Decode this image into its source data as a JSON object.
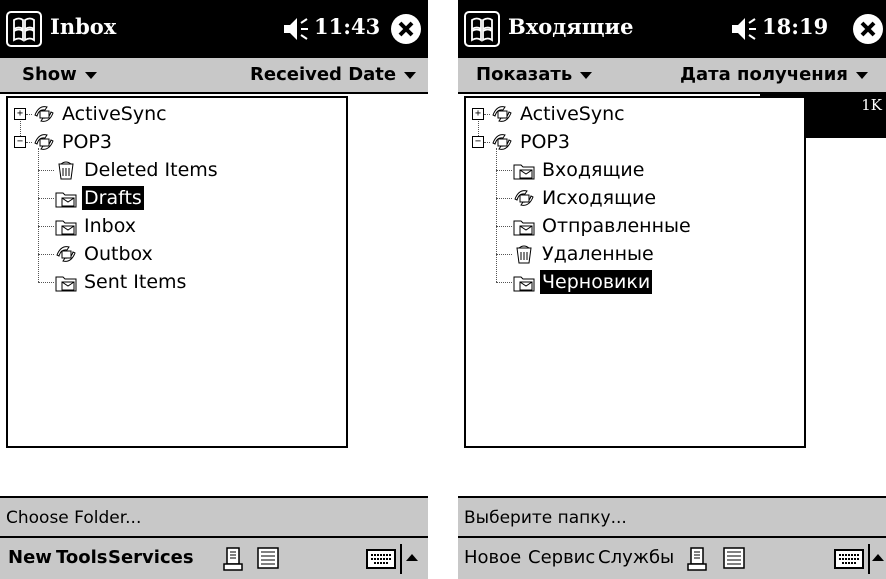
{
  "left": {
    "title": "Inbox",
    "time": "11:43",
    "menu": {
      "show": "Show",
      "sort": "Received Date"
    },
    "tree": [
      {
        "label": "ActiveSync",
        "icon": "activesync-icon",
        "level": 0,
        "expander": "+"
      },
      {
        "label": "POP3",
        "icon": "pop3-account-icon",
        "level": 0,
        "expander": "−"
      },
      {
        "label": "Deleted Items",
        "icon": "deleted-items-icon",
        "level": 1
      },
      {
        "label": "Drafts",
        "icon": "drafts-icon",
        "level": 1,
        "selected": true
      },
      {
        "label": "Inbox",
        "icon": "inbox-folder-icon",
        "level": 1
      },
      {
        "label": "Outbox",
        "icon": "outbox-icon",
        "level": 1
      },
      {
        "label": "Sent Items",
        "icon": "sent-items-icon",
        "level": 1
      }
    ],
    "status": "Choose Folder...",
    "commands": [
      "New",
      "Tools",
      "Services"
    ]
  },
  "right": {
    "title": "Входящие",
    "time": "18:19",
    "menu": {
      "show": "Показать",
      "sort": "Дата получения"
    },
    "panel_text": "1K",
    "tree": [
      {
        "label": "ActiveSync",
        "icon": "activesync-icon",
        "level": 0,
        "expander": "+"
      },
      {
        "label": "POP3",
        "icon": "pop3-account-icon",
        "level": 0,
        "expander": "−"
      },
      {
        "label": "Входящие",
        "icon": "inbox-folder-icon",
        "level": 1
      },
      {
        "label": "Исходящие",
        "icon": "outbox-icon",
        "level": 1
      },
      {
        "label": "Отправленные",
        "icon": "sent-items-icon",
        "level": 1
      },
      {
        "label": "Удаленные",
        "icon": "deleted-items-icon",
        "level": 1
      },
      {
        "label": "Черновики",
        "icon": "drafts-icon",
        "level": 1,
        "selected": true
      }
    ],
    "status": "Выберите папку...",
    "commands": [
      "Новое",
      "Сервис",
      "Службы"
    ]
  },
  "colors": {
    "titlebar": "#000000",
    "bars": "#c8c8c8",
    "selection": "#000000"
  }
}
